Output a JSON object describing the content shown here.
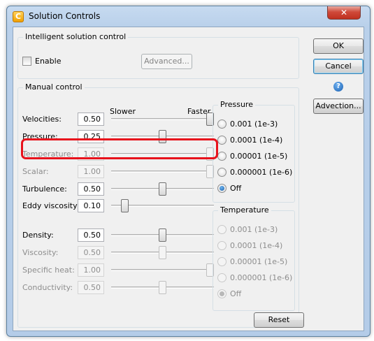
{
  "window": {
    "title": "Solution Controls",
    "close_glyph": "✕",
    "app_icon_glyph": "C"
  },
  "intelligent": {
    "title": "Intelligent solution control",
    "enable_label": "Enable",
    "advanced_button": "Advanced..."
  },
  "manual": {
    "title": "Manual control",
    "slower_label": "Slower",
    "faster_label": "Faster",
    "rows": [
      {
        "label": "Velocities:",
        "value": "0.50",
        "enabled": true,
        "level": 1.0
      },
      {
        "label": "Pressure:",
        "value": "0.25",
        "enabled": true,
        "level": 0.5
      },
      {
        "label": "Temperature:",
        "value": "1.00",
        "enabled": false,
        "level": 1.0
      },
      {
        "label": "Scalar:",
        "value": "1.00",
        "enabled": false,
        "level": 1.0
      },
      {
        "label": "Turbulence:",
        "value": "0.50",
        "enabled": true,
        "level": 0.5
      },
      {
        "label": "Eddy viscosity:",
        "value": "0.10",
        "enabled": true,
        "level": 0.1
      },
      {
        "label": "Density:",
        "value": "0.50",
        "enabled": true,
        "level": 0.5
      },
      {
        "label": "Viscosity:",
        "value": "0.50",
        "enabled": false,
        "level": 0.5
      },
      {
        "label": "Specific heat:",
        "value": "1.00",
        "enabled": false,
        "level": 1.0
      },
      {
        "label": "Conductivity:",
        "value": "0.50",
        "enabled": false,
        "level": 0.5
      }
    ]
  },
  "pressure_group": {
    "title": "Pressure",
    "options": [
      "0.001 (1e-3)",
      "0.0001 (1e-4)",
      "0.00001 (1e-5)",
      "0.000001 (1e-6)",
      "Off"
    ],
    "selected": "Off"
  },
  "temperature_group": {
    "title": "Temperature",
    "options": [
      "0.001 (1e-3)",
      "0.0001 (1e-4)",
      "0.00001 (1e-5)",
      "0.000001 (1e-6)",
      "Off"
    ],
    "selected": "Off",
    "enabled": false
  },
  "buttons": {
    "ok": "OK",
    "cancel": "Cancel",
    "advection": "Advection...",
    "reset": "Reset",
    "help_glyph": "?"
  },
  "colors": {
    "highlight": "#e8121c",
    "radio_selected": "#1d5fa8",
    "title_bar": "#b9d0ea"
  }
}
